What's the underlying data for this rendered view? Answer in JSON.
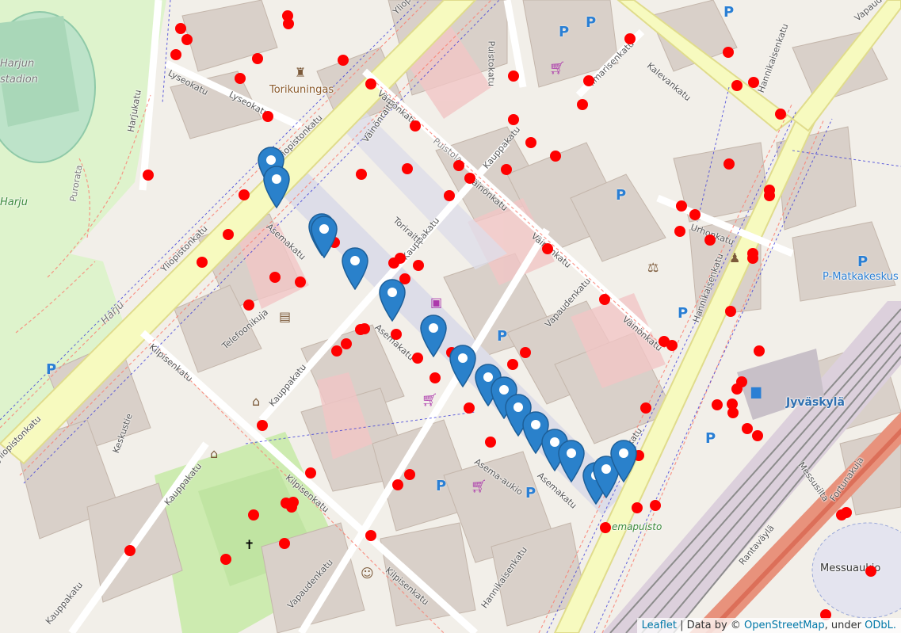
{
  "map": {
    "attribution": {
      "leaflet": "Leaflet",
      "sep": " | Data by © ",
      "osm": "OpenStreetMap",
      "under": ", under ",
      "odbl": "ODbL."
    },
    "labels": {
      "yliopistonkatu_top": "Yliopistonkatu",
      "yliopistonkatu_mid": "Yliopistonkatu",
      "yliopistonkatu_left": "Yliopistonkatu",
      "yliopistonkatu_bottom": "yliopistonkatu",
      "lyseokatu": "Lyseokatu",
      "lyseokatu2": "Lyseokatu",
      "torikuningas": "Torikuningas",
      "vainonkatu_top": "Väinönkatu",
      "vainonkatu_mid": "Väinönkatu",
      "vainonkatu_right": "Väinönkatu",
      "vainonraitti": "Väinönraitti",
      "puistola": "Puistola",
      "puistokatu": "Puistokatu",
      "kauppakatu_top": "Kauppakatu",
      "kauppakatu_mid": "Kauppakatu",
      "kauppakatu_low": "Kauppakatu",
      "kauppakatu_bl": "Kauppakatu",
      "kauppakatu_bl2": "Kauppakatu",
      "asemakatu_top": "Asemakatu",
      "asemakatu_mid": "Asemakatu",
      "asemakatu_low": "Asemakatu",
      "toriraitti": "Toriraitti",
      "telefoonikuja": "Telefoonikuja",
      "kilpisenkatu_left": "Kilpisenkatu",
      "kilpisenkatu_mid": "Kilpisenkatu",
      "kilpisenkatu_low": "Kilpisenkatu",
      "keskustie": "Keskustie",
      "harju": "Harju",
      "harjukatu": "Harjukatu",
      "purorata": "Purorata",
      "vapaudenkatu_mid": "Vapaudenkatu",
      "vapaudenkatu_low": "Vapaudenkatu",
      "vapaudenkatu_top": "Vapaude",
      "kalevankatu": "Kalevankatu",
      "ilmarisenkatu": "Ilmarisenkatu",
      "urhonkatu": "Urhonkatu",
      "hannikaisenkatu_top": "Hannikaisenkatu",
      "hannikaisenkatu_mid": "Hannikaisenkatu",
      "hannikaisenkatu_low": "Hannikaisenkatu",
      "hannikaisenkatu_bl": "Hannikaisenkatu",
      "asema_aukio": "Asema-aukio",
      "jyvaskyla": "Jyväskylä",
      "messusilta": "Messusilta",
      "fortunakuja": "Fortunakuja",
      "rantavayla": "Rantaväylä",
      "messuaukio": "Messuaukio",
      "pmatkakeskus": "P-Matkakeskus",
      "emapuisto": "emapuisto",
      "harjun_stadion1": "Harjun",
      "harjun_stadion2": "stadion",
      "harju_green": "Harju"
    },
    "icons": {
      "parking": "parking-icon",
      "shop": "shopping-cart-icon",
      "museum": "museum-icon",
      "church": "church-icon",
      "cinema": "cinema-icon",
      "court": "court-icon",
      "police": "police-icon",
      "bus": "bus-station-icon",
      "theatre": "theatre-icon",
      "gift": "gift-shop-icon",
      "monument": "monument-icon",
      "marker": "map-pin-marker-icon"
    },
    "colors": {
      "background": "#f2efe9",
      "building": "#d9d0c9",
      "pedestrian": "#dddde8",
      "green": "#cdebb0",
      "park": "#c8facc",
      "main_road": "#f7fabf",
      "railway": "#999999",
      "marker": "#2a81cb",
      "red_dot": "#ff0000",
      "parking_text": "#2a7fd4"
    },
    "parking_symbol": "P"
  }
}
